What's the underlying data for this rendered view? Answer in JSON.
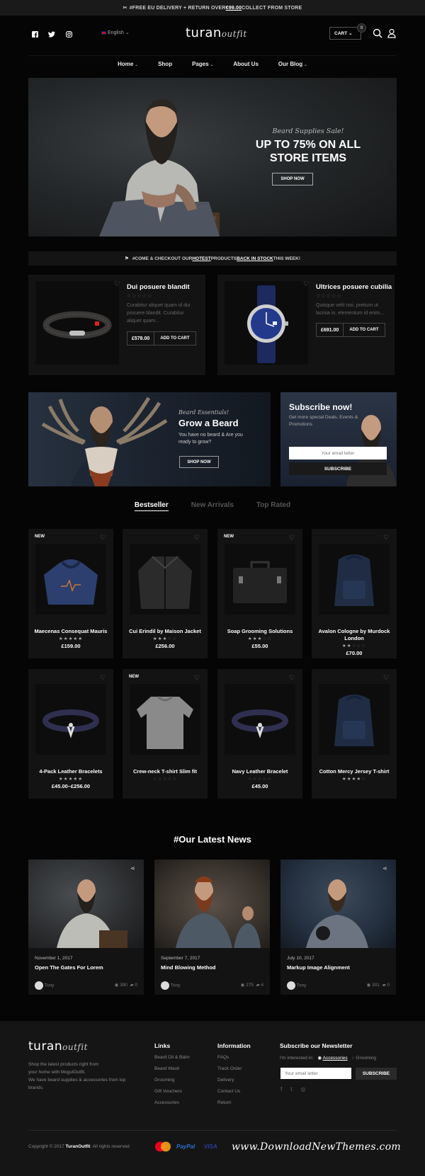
{
  "topbar": {
    "pre": "#FREE EU DELIVERY + RETURN OVER ",
    "amount": "€99.00",
    "post": " COLLECT FROM STORE"
  },
  "header": {
    "language": "English",
    "logo_main": "turan",
    "logo_script": "outfit",
    "cart_label": "CART",
    "cart_count": "0"
  },
  "nav": {
    "items": [
      "Home",
      "Shop",
      "Pages",
      "About Us",
      "Our Blog"
    ]
  },
  "hero": {
    "script": "Beard Supplies Sale!",
    "title_line1": "UP TO 75% ON ALL",
    "title_line2": "STORE ITEMS",
    "button": "SHOP NOW"
  },
  "notice": {
    "t1": "#COME & CHECKOUT OUR ",
    "hot": "HOTEST",
    "t2": " PRODUCTS ",
    "stock": "BACK IN STOCK",
    "t3": " THIS WEEK!"
  },
  "featured": [
    {
      "title": "Dui posuere blandit",
      "desc": "Curabitur aliquet quam id dui posuere blandit. Curabitur aliquet quam...",
      "price": "£578.00",
      "button": "ADD TO CART",
      "rating": 0
    },
    {
      "title": "Ultrices posuere cubilia",
      "desc": "Quisque velit nisi, pretium ut lacinia in, elementum id enim...",
      "price": "£691.00",
      "button": "ADD TO CART",
      "rating": 0
    }
  ],
  "grow": {
    "script": "Beard Essentials!",
    "title": "Grow a Beard",
    "text1": "You have no beard & Are you",
    "text2": "ready to grow?",
    "button": "SHOP NOW"
  },
  "subscribe": {
    "title": "Subscribe now!",
    "text1": "Get more special Deals, Events &",
    "text2": "Promotions",
    "placeholder": "Your email letter",
    "button": "SUBSCRIBE"
  },
  "tabs": [
    "Bestseller",
    "New Arrivals",
    "Top Rated"
  ],
  "products": [
    {
      "name": "Maecenas Consequat Mauris",
      "price": "£159.00",
      "rating": 5,
      "new": true,
      "icon": "hoodie-icon"
    },
    {
      "name": "Cui Erindil by Maison Jacket",
      "price": "£256.00",
      "rating": 3,
      "new": false,
      "icon": "jacket-icon"
    },
    {
      "name": "Soap Grooming Solutions",
      "price": "£55.00",
      "rating": 3,
      "new": true,
      "icon": "briefcase-icon"
    },
    {
      "name": "Avalon Cologne by Murdock",
      "name2": "London",
      "price": "£70.00",
      "rating": 2,
      "new": false,
      "icon": "backpack-icon"
    },
    {
      "name": "4-Pack Leather Bracelets",
      "price": "£45.00–£256.00",
      "rating": 5,
      "new": false,
      "icon": "bracelet-icon"
    },
    {
      "name": "Crew-neck T-shirt Slim fit",
      "price": "",
      "rating": 0,
      "new": true,
      "icon": "sweater-icon"
    },
    {
      "name": "Navy Leather Bracelet",
      "price": "£45.00",
      "rating": 0,
      "new": false,
      "icon": "bracelet-icon"
    },
    {
      "name": "Cotton Mercy Jersey T-shirt",
      "price": "",
      "rating": 4,
      "new": false,
      "icon": "backpack-icon"
    }
  ],
  "new_label": "NEW",
  "news": {
    "heading": "#Our Latest News",
    "posts": [
      {
        "date": "November 1, 2017",
        "title": "Open The Gates For Lorem",
        "author": "Tony",
        "views": "390",
        "comments": "0"
      },
      {
        "date": "September 7, 2017",
        "title": "Mind Blowing Method",
        "author": "Tony",
        "views": "275",
        "comments": "4"
      },
      {
        "date": "July 10, 2017",
        "title": "Markup Image Alignment",
        "author": "Tony",
        "views": "301",
        "comments": "0"
      }
    ]
  },
  "footer": {
    "about1": "Shop the latest products right from",
    "about2": "your home with MogulOutfit.",
    "about3": "We have beard supplies & accessories from top",
    "about4": "brands.",
    "links_heading": "Links",
    "links": [
      "Beard Oil & Balm",
      "Beard Wash",
      "Grooming",
      "Gift Vouchers",
      "Accessories"
    ],
    "info_heading": "Information",
    "info": [
      "FAQs",
      "Track Order",
      "Delivery",
      "Contact Us",
      "Return"
    ],
    "newsletter_heading": "Subscribe our Newsletter",
    "interested": "I'm interested in:",
    "opt1": "Accessories",
    "opt2": "Grooming",
    "placeholder": "Your email letter",
    "button": "SUBSCRIBE",
    "copy_pre": "Copyright © 2017 ",
    "copy_brand": "TuranOutfit",
    "copy_post": ". All rights reserved",
    "paypal": "PayPal",
    "visa": "VISA",
    "watermark": "www.DownloadNewThemes.com"
  },
  "colors": {
    "background": "#050505",
    "card": "#131313",
    "footer": "#151515",
    "accent_white": "#ffffff"
  }
}
